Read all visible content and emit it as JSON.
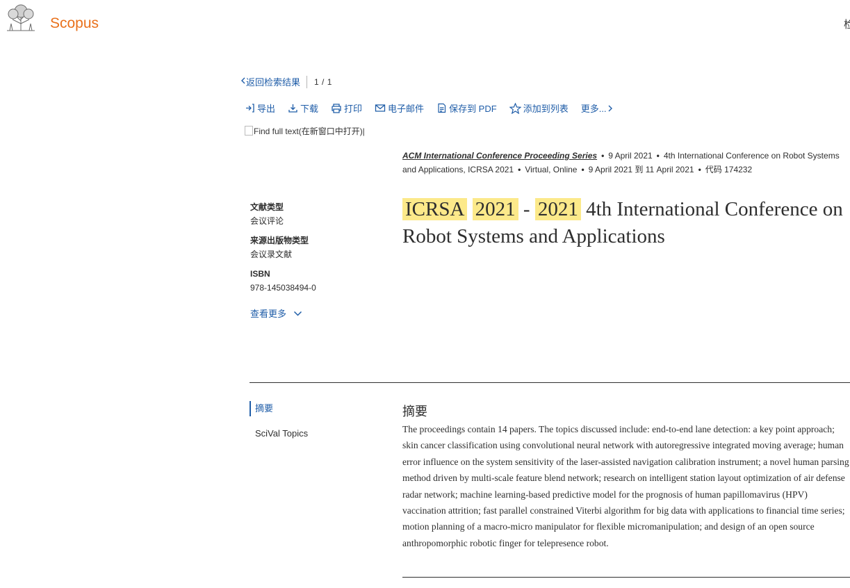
{
  "header": {
    "brand": "Scopus",
    "right_text": "检"
  },
  "nav": {
    "back_label": "返回检索结果",
    "pagination": "1 / 1"
  },
  "toolbar": {
    "export": "导出",
    "download": "下载",
    "print": "打印",
    "email": "电子邮件",
    "save_pdf": "保存到 PDF",
    "add_list": "添加到列表",
    "more": "更多..."
  },
  "fulltext_alt": "Find full text(在新窗口中打开)|",
  "source": {
    "series": "ACM International Conference Proceeding Series",
    "date": "9 April 2021",
    "conference": "4th International Conference on Robot Systems and Applications, ICRSA 2021",
    "location": "Virtual, Online",
    "dates_range": "9 April 2021 到 11 April 2021",
    "code": "代码 174232"
  },
  "title": {
    "hl1": "ICRSA",
    "hl2": "2021",
    "dash": "-",
    "hl3": "2021",
    "rest": "4th International Conference on Robot Systems and Applications"
  },
  "details": {
    "doc_type_label": "文献类型",
    "doc_type_value": "会议评论",
    "source_type_label": "来源出版物类型",
    "source_type_value": "会议录文献",
    "isbn_label": "ISBN",
    "isbn_value": "978-145038494-0",
    "see_more": "查看更多"
  },
  "sidenav": {
    "abstract": "摘要",
    "scival": "SciVal Topics"
  },
  "abstract": {
    "heading": "摘要",
    "text": "The proceedings contain 14 papers. The topics discussed include: end-to-end lane detection: a key point approach; skin cancer classification using convolutional neural network with autoregressive integrated moving average; human error influence on the system sensitivity of the laser-assisted navigation calibration instrument; a novel human parsing method driven by multi-scale feature blend network; research on intelligent station layout optimization of air defense radar network; machine learning-based predictive model for the prognosis of human papillomavirus (HPV) vaccination attrition; fast parallel constrained Viterbi algorithm for big data with applications to financial time series; motion planning of a macro-micro manipulator for flexible micromanipulation; and design of an open source anthropomorphic robotic finger for telepresence robot."
  },
  "colors": {
    "brand": "#e9711c",
    "link": "#1f5da8",
    "highlight": "#fce98a"
  }
}
